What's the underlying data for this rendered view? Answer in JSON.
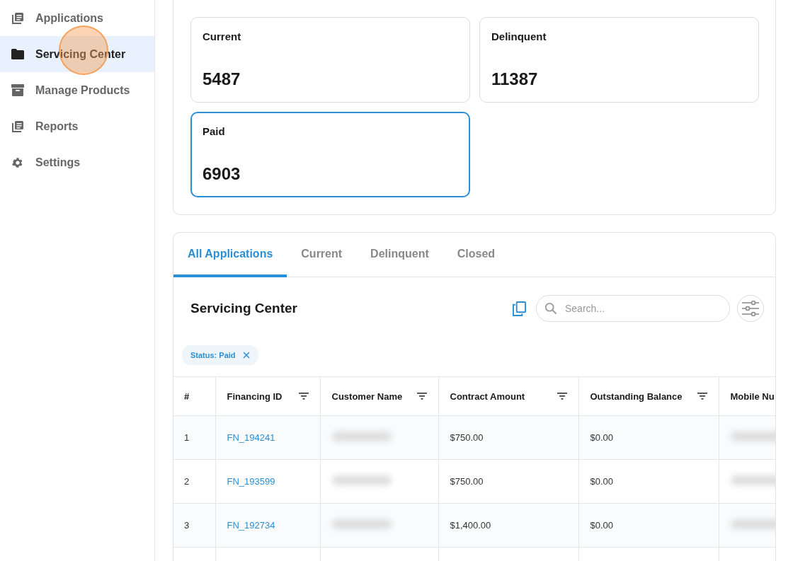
{
  "sidebar": {
    "items": [
      {
        "label": "Applications",
        "kind": "stack",
        "selected": false
      },
      {
        "label": "Servicing Center",
        "kind": "folder",
        "selected": true
      },
      {
        "label": "Manage Products",
        "kind": "archive",
        "selected": false
      },
      {
        "label": "Reports",
        "kind": "stack",
        "selected": false
      },
      {
        "label": "Settings",
        "kind": "gear",
        "selected": false
      }
    ]
  },
  "summary_cards": [
    {
      "label": "Current",
      "value": "5487",
      "selected": false
    },
    {
      "label": "Delinquent",
      "value": "11387",
      "selected": false
    },
    {
      "label": "Paid",
      "value": "6903",
      "selected": true
    }
  ],
  "tabs": [
    {
      "label": "All Applications",
      "selected": true
    },
    {
      "label": "Current",
      "selected": false
    },
    {
      "label": "Delinquent",
      "selected": false
    },
    {
      "label": "Closed",
      "selected": false
    }
  ],
  "table_title": "Servicing Center",
  "search": {
    "placeholder": "Search..."
  },
  "filter_chips": [
    {
      "label": "Status: Paid"
    }
  ],
  "table": {
    "columns": [
      {
        "label": "#",
        "filter": false
      },
      {
        "label": "Financing ID",
        "filter": true
      },
      {
        "label": "Customer Name",
        "filter": true
      },
      {
        "label": "Contract Amount",
        "filter": true
      },
      {
        "label": "Outstanding Balance",
        "filter": true
      },
      {
        "label": "Mobile Nu"
      }
    ],
    "rows": [
      {
        "index": "1",
        "financing_id": "FN_194241",
        "contract_amount": "$750.00",
        "outstanding_balance": "$0.00"
      },
      {
        "index": "2",
        "financing_id": "FN_193599",
        "contract_amount": "$750.00",
        "outstanding_balance": "$0.00"
      },
      {
        "index": "3",
        "financing_id": "FN_192734",
        "contract_amount": "$1,400.00",
        "outstanding_balance": "$0.00"
      }
    ]
  }
}
